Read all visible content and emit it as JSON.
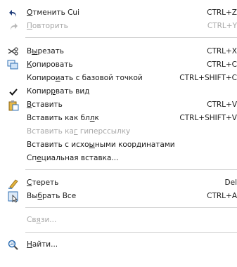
{
  "menu": {
    "undo": {
      "label": "Отменить Cui",
      "shortcut": "CTRL+Z"
    },
    "redo": {
      "label": "Повторить",
      "shortcut": "CTRL+Y"
    },
    "cut": {
      "label": "Вырезать",
      "shortcut": "CTRL+X"
    },
    "copy": {
      "label": "Копировать",
      "shortcut": "CTRL+C"
    },
    "copy_base": {
      "label": "Копировать с базовой точкой",
      "shortcut": "CTRL+SHIFT+C"
    },
    "copy_view": {
      "label": "Копировать вид",
      "checked": true
    },
    "paste": {
      "label": "Вставить",
      "shortcut": "CTRL+V"
    },
    "paste_block": {
      "label": "Вставить как блок",
      "shortcut": "CTRL+SHIFT+V"
    },
    "paste_hyperlink": {
      "label": "Вставить как гиперссылку"
    },
    "paste_coords": {
      "label": "Вставить с исходными координатами"
    },
    "paste_special": {
      "label": "Специальная вставка..."
    },
    "erase": {
      "label": "Стереть",
      "shortcut": "Del"
    },
    "select_all": {
      "label": "Выбрать Все",
      "shortcut": "CTRL+A"
    },
    "links": {
      "label": "Связи..."
    },
    "find": {
      "label": "Найти..."
    }
  },
  "colors": {
    "disabled": "#a8a8a8",
    "separator": "#cfcfcf",
    "text": "#1a1a1a"
  }
}
